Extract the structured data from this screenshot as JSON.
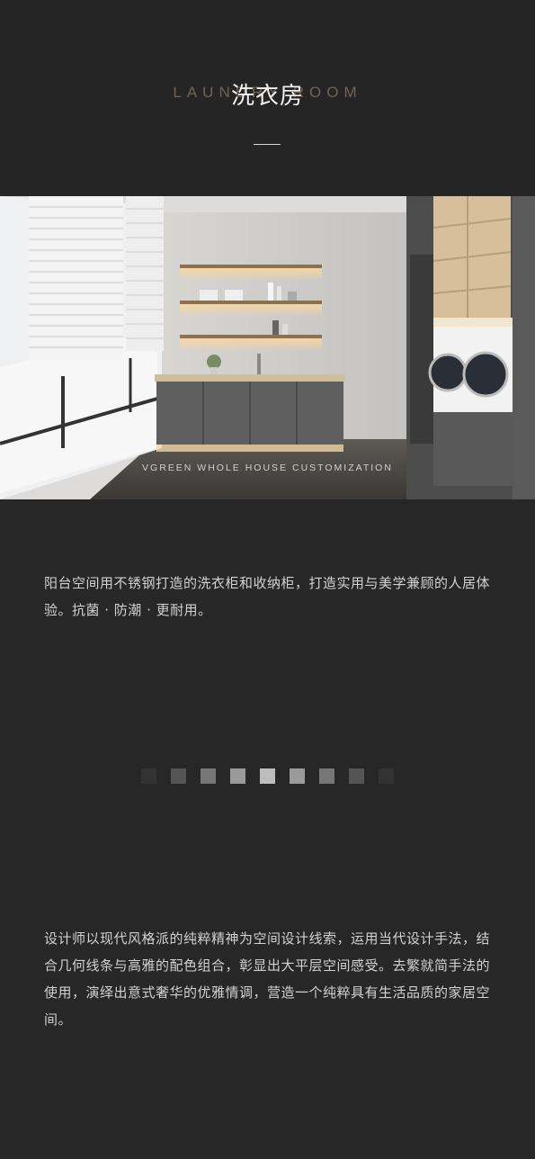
{
  "header": {
    "title_en": "LAUNDRY ROOM",
    "title_cn": "洗衣房"
  },
  "photo": {
    "watermark": "VGREEN WHOLE HOUSE CUSTOMIZATION"
  },
  "paragraphs": [
    "阳台空间用不锈钢打造的洗衣柜和收纳柜，打造实用与美学兼顾的人居体验。抗菌 · 防潮 · 更耐用。",
    "设计师以现代风格派的纯粹精神为空间设计线索，运用当代设计手法，结合几何线条与高雅的配色组合，彰显出大平层空间感受。去繁就简手法的使用，演绎出意式奢华的优雅情调，营造一个纯粹具有生活品质的家居空间。"
  ],
  "decor_squares": [
    "#333333",
    "#555555",
    "#777777",
    "#9a9a9a",
    "#bdbdbd",
    "#9a9a9a",
    "#777777",
    "#555555",
    "#333333"
  ]
}
